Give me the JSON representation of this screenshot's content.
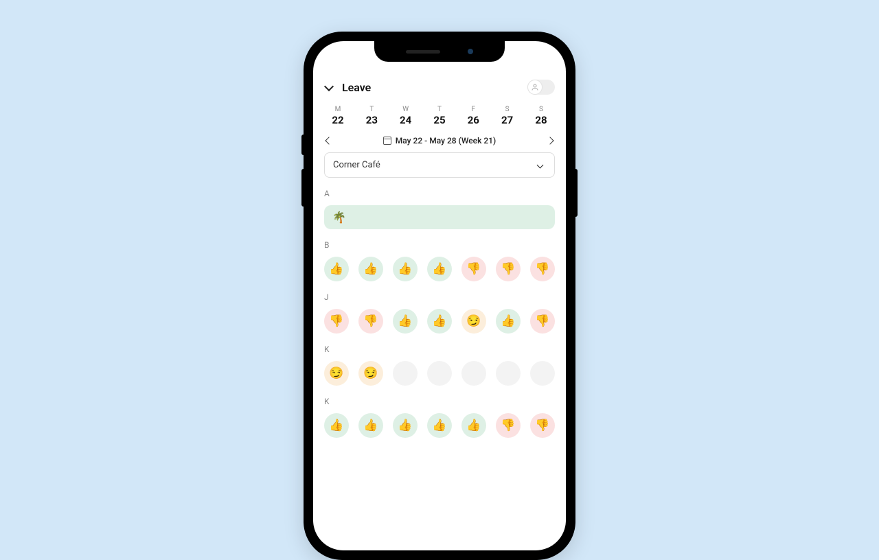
{
  "header": {
    "title": "Leave"
  },
  "weekdays": [
    {
      "letter": "M",
      "num": "22"
    },
    {
      "letter": "T",
      "num": "23"
    },
    {
      "letter": "W",
      "num": "24"
    },
    {
      "letter": "T",
      "num": "25"
    },
    {
      "letter": "F",
      "num": "26"
    },
    {
      "letter": "S",
      "num": "27"
    },
    {
      "letter": "S",
      "num": "28"
    }
  ],
  "week_range": "May 22 - May 28 (Week 21)",
  "location_select": "Corner Café",
  "icons": {
    "palm": "🌴",
    "thumb_up": "👍",
    "thumb_down": "👎",
    "maybe": "😏"
  },
  "sections": [
    {
      "label": "A",
      "type": "leave"
    },
    {
      "label": "B",
      "cells": [
        "up",
        "up",
        "up",
        "up",
        "down",
        "down",
        "down"
      ]
    },
    {
      "label": "J",
      "cells": [
        "down",
        "down",
        "up",
        "up",
        "maybe",
        "up",
        "down"
      ]
    },
    {
      "label": "K",
      "cells": [
        "maybe",
        "maybe",
        "empty",
        "empty",
        "empty",
        "empty",
        "empty"
      ]
    },
    {
      "label": "K",
      "cells": [
        "up",
        "up",
        "up",
        "up",
        "up",
        "down",
        "down"
      ]
    }
  ]
}
